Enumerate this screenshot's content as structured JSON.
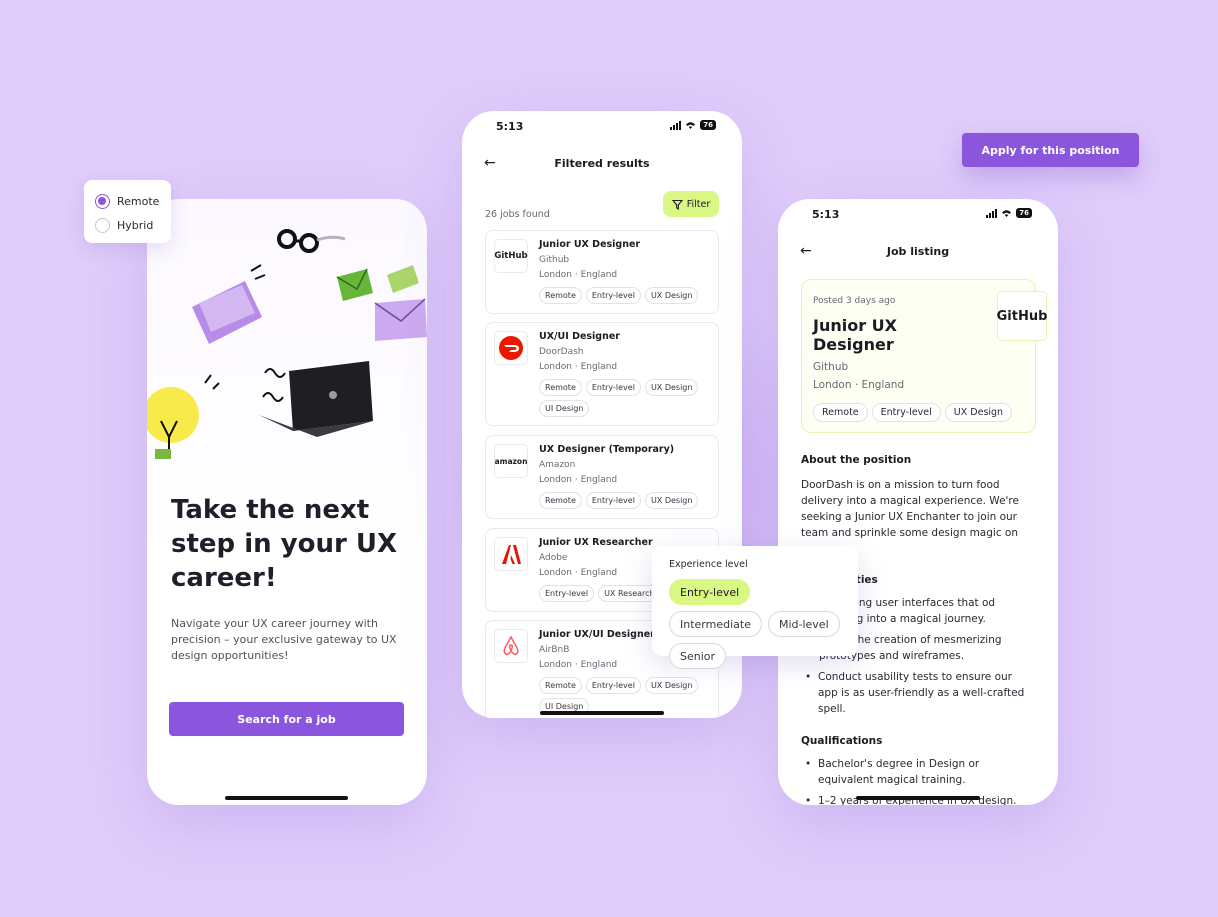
{
  "colors": {
    "background": "#e0cdfb",
    "primary": "#8b55dd",
    "accent": "#d9f783"
  },
  "work_type": {
    "options": [
      {
        "label": "Remote",
        "selected": true
      },
      {
        "label": "Hybrid",
        "selected": false
      }
    ]
  },
  "apply_button": {
    "label": "Apply for this position"
  },
  "onboarding": {
    "title": "Take the next step in your UX career!",
    "description": "Navigate your UX career journey with precision – your exclusive gateway to UX design opportunities!",
    "cta": "Search for a job"
  },
  "results": {
    "status_time": "5:13",
    "battery": "76",
    "title": "Filtered results",
    "count": "26 jobs found",
    "filter_label": "Filter",
    "jobs": [
      {
        "title": "Junior UX Designer",
        "company": "Github",
        "location": "London · England",
        "logo": "GitHub",
        "tags": [
          "Remote",
          "Entry-level",
          "UX Design"
        ]
      },
      {
        "title": "UX/UI Designer",
        "company": "DoorDash",
        "location": "London · England",
        "logo": "doordash",
        "tags": [
          "Remote",
          "Entry-level",
          "UX Design",
          "UI Design"
        ]
      },
      {
        "title": "UX Designer (Temporary)",
        "company": "Amazon",
        "location": "London · England",
        "logo": "amazon",
        "tags": [
          "Remote",
          "Entry-level",
          "UX Design"
        ]
      },
      {
        "title": "Junior UX Researcher",
        "company": "Adobe",
        "location": "London · England",
        "logo": "adobe",
        "tags": [
          "Entry-level",
          "UX Research"
        ]
      },
      {
        "title": "Junior UX/UI Designer",
        "company": "AirBnB",
        "location": "London · England",
        "logo": "airbnb",
        "tags": [
          "Remote",
          "Entry-level",
          "UX Design",
          "UI Design"
        ]
      }
    ]
  },
  "experience": {
    "title": "Experience level",
    "options": [
      {
        "label": "Entry-level",
        "selected": true
      },
      {
        "label": "Intermediate",
        "selected": false
      },
      {
        "label": "Mid-level",
        "selected": false
      },
      {
        "label": "Senior",
        "selected": false
      }
    ]
  },
  "listing": {
    "status_time": "5:13",
    "battery": "76",
    "title": "Job listing",
    "posted": "Posted 3 days ago",
    "job_title": "Junior UX Designer",
    "company": "Github",
    "location": "London · England",
    "logo": "GitHub",
    "tags": [
      "Remote",
      "Entry-level",
      "UX Design"
    ],
    "about_heading": "About the position",
    "about_text": "DoorDash is on a mission to turn food delivery into a magical experience. We're seeking a Junior UX Enchanter to join our team and sprinkle some design magic on",
    "responsibilities_heading": "ilities",
    "responsibilities": [
      "aptivating user interfaces that od ordering into a magical journey.",
      "ute to the creation of mesmerizing prototypes and wireframes.",
      "Conduct usability tests to ensure our app is as user-friendly as a well-crafted spell."
    ],
    "qualifications_heading": "Qualifications",
    "qualifications": [
      "Bachelor's degree in Design or equivalent magical training.",
      "1–2 years of experience in UX design."
    ]
  }
}
